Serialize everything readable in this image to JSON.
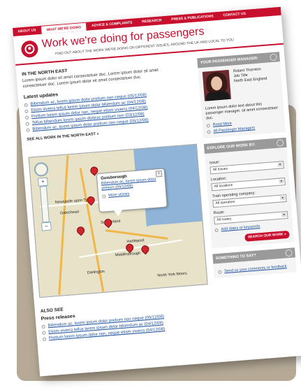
{
  "nav": {
    "items": [
      {
        "label": "About us",
        "active": false
      },
      {
        "label": "What we're doing",
        "active": true
      },
      {
        "label": "Advice & complaints",
        "active": false
      },
      {
        "label": "Research",
        "active": false
      },
      {
        "label": "Press & publications",
        "active": false
      },
      {
        "label": "Contact us",
        "active": false
      }
    ]
  },
  "header": {
    "title": "Work we're doing for passengers",
    "subtitle": "Find out about the work we're doing on different issues, around the UK and local to you"
  },
  "region": {
    "title": "In the North East",
    "intro": "Lorem ipsum dolor sit amet consectetuer duc. Lorem ipsum dolor sit amet consectetuer duc. Lorem ipsum dolor sit amet consectetuer duc.",
    "updates_title": "Latest updates",
    "updates": [
      "Bibendum ac, lorem ipsum dolor pretium non neque (05/12/08)",
      "Etiam viverra tellus lorem ipsum dolor bibendum ac (04/12/08)",
      "Pretium lorem ipsum dolor non, neque etiam viverra (04/12/08)",
      "Tellus bibendum lorem ipsum dolorac pretium non (03/12/08)",
      "Bibendum ac, lorem ipsum dolor pretium non neque (05/12/08)"
    ],
    "see_all": "See all work in the North East »"
  },
  "map": {
    "labels": [
      "Newcastle upon Tyne",
      "Gateshead",
      "Sunderland",
      "Hartlepool",
      "Middlesbrough",
      "Darlington",
      "North York Moors"
    ],
    "popup": {
      "title": "Guisborough",
      "body": "Bibendum ac, lorem ipsum dolor pretium (04/12/08)",
      "more": "More stories"
    }
  },
  "also_see": {
    "title": "Also see",
    "press_title": "Press releases",
    "items": [
      "Bibendum ac, lorem ipsum dolor pretium non neque (05/12/08)",
      "Etiam viverra tellus lorem ipsum dolor bibendum ac (04/12/08)",
      "Pretium lorem ipsum dolor non, neque etiam viverra (04/12/08)"
    ]
  },
  "sidebar": {
    "manager": {
      "head": "Your passenger manager:",
      "name": "Robert Thornton",
      "job": "Job Title",
      "region": "North East England",
      "text": "Lorem ipsum dolor text about this passenger manager, sit amet consectetuer duc.",
      "read_more": "Read More",
      "all_managers": "All Passenger Managers"
    },
    "explore": {
      "head": "Explore our work by:",
      "issue_label": "Issue:",
      "issue_value": "All Issues",
      "location_label": "Location:",
      "location_value": "All locations",
      "operator_label": "Train operating company:",
      "operator_value": "All operators",
      "route_label": "Route:",
      "route_value": "All routes",
      "add_dates": "Add dates or keywords",
      "search_button": "Search our work »"
    },
    "say": {
      "head": "Something to say?",
      "link": "Send us your comments or feedback"
    }
  },
  "colors": {
    "brand_red": "#c8102e",
    "panel_gray": "#9a9a9a",
    "link_blue": "#1a4f9c",
    "backdrop_taupe": "#b6aa97"
  }
}
